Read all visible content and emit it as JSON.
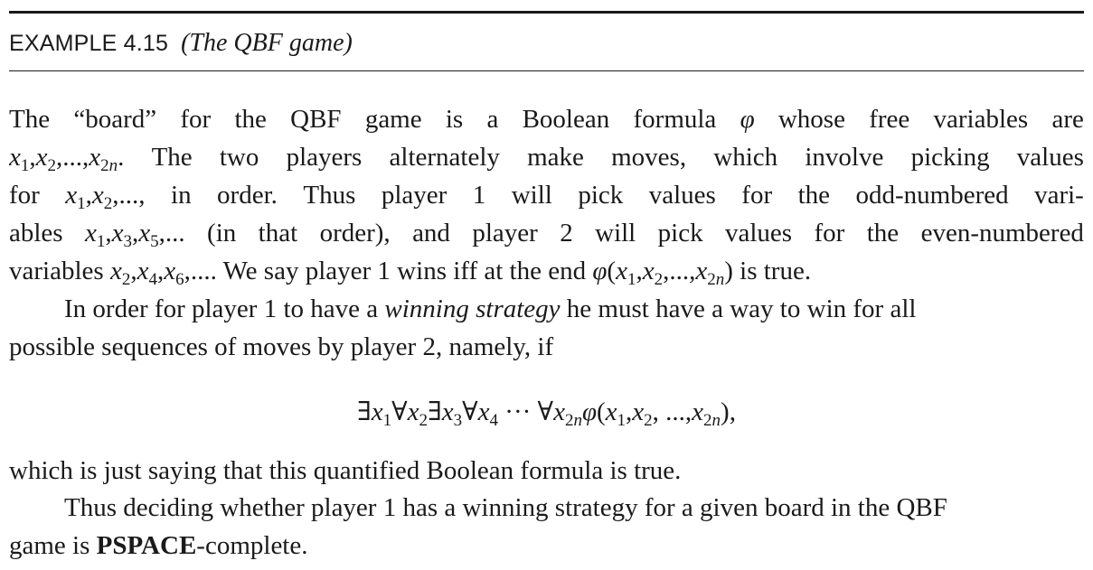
{
  "header": {
    "label": "EXAMPLE 4.15",
    "title": "(The QBF game)"
  },
  "p1": {
    "l1": [
      "The",
      "“board”",
      "for",
      "the",
      "QBF",
      "game",
      "is",
      "a",
      "Boolean",
      "formula",
      "φ",
      "whose",
      "free",
      "variables",
      "are"
    ],
    "l2": [
      "x1,x2,...,x2n.",
      "The",
      "two",
      "players",
      "alternately",
      "make",
      "moves,",
      "which",
      "involve",
      "picking",
      "values"
    ],
    "l3": [
      "for",
      "x1,x2,...,",
      "in",
      "order.",
      "Thus",
      "player",
      "1",
      "will",
      "pick",
      "values",
      "for",
      "the",
      "odd-numbered",
      "vari-"
    ],
    "l4": [
      "ables",
      "x1,x3,x5,...",
      "(in",
      "that",
      "order),",
      "and",
      "player",
      "2",
      "will",
      "pick",
      "values",
      "for",
      "the",
      "even-numbered"
    ],
    "l5": "variables x2,x4,x6,.... We say player 1 wins iff at the end φ(x1,x2,...,x2n) is true."
  },
  "p2": {
    "l1": "In order for player 1 to have a winning strategy he must have a way to win for all",
    "l2": "possible sequences of moves by player 2, namely, if"
  },
  "formula": "∃x1∀x2∃x3∀x4 ··· ∀x2nφ(x1,x2, ...,x2n),",
  "p3": "which is just saying that this quantified Boolean formula is true.",
  "p4": {
    "l1": "Thus deciding whether player 1 has a winning strategy for a given board in the QBF",
    "l2_prefix": "game is",
    "l2_bold": "PSPACE",
    "l2_suffix": "-complete."
  }
}
